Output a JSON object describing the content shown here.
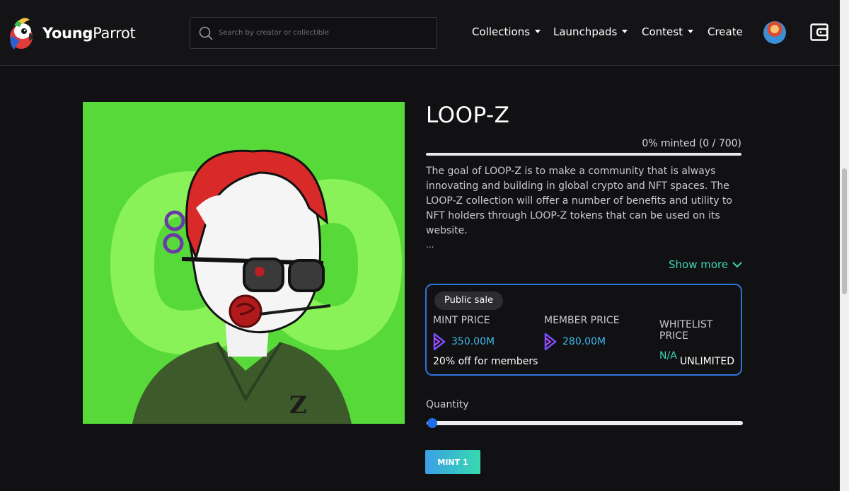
{
  "header": {
    "logo_bold": "Young",
    "logo_light": "Parrot",
    "search_placeholder": "Search by creator or collectible",
    "nav": {
      "collections": "Collections",
      "launchpads": "Launchpads",
      "contest": "Contest",
      "create": "Create"
    },
    "icons": [
      "parrot-logo-icon",
      "search-icon",
      "caret-down-icon",
      "avatar",
      "wallet-icon"
    ]
  },
  "collection": {
    "title": "LOOP-Z",
    "minted_text": "0% minted (0 / 700)",
    "minted_fraction": 0.0,
    "description": "The goal of LOOP-Z is to make a community that is always innovating and building in global crypto and NFT spaces. The LOOP-Z collection will offer a number of benefits and utility to NFT holders through LOOP-Z tokens that can be used on its website.",
    "ellipsis": "...",
    "show_more": "Show more"
  },
  "sale": {
    "badge": "Public sale",
    "mint_price_label": "MINT PRICE",
    "mint_price_value": "350.00M",
    "member_price_label": "MEMBER PRICE",
    "member_price_value": "280.00M",
    "whitelist_price_label": "WHITELIST PRICE",
    "whitelist_price_value": "N/A",
    "discount": "20% off for members",
    "limit": "UNLIMITED"
  },
  "quantity": {
    "label": "Quantity",
    "level": 0.0
  },
  "mint_button": "MINT 1",
  "colors": {
    "background": "#111114",
    "accent_blue": "#2f73d9",
    "accent_teal": "#3fd4b3",
    "art_green": "#57d93a"
  }
}
